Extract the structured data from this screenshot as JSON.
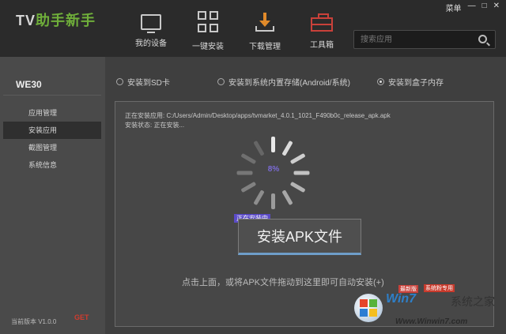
{
  "app": {
    "logo_prefix": "TV",
    "logo_main": "助手新手",
    "window_controls": [
      "菜单",
      "—",
      "□",
      "✕"
    ]
  },
  "nav": [
    {
      "label": "我的设备",
      "icon": "monitor-icon"
    },
    {
      "label": "一键安装",
      "icon": "grid-icon"
    },
    {
      "label": "下载管理",
      "icon": "download-icon"
    },
    {
      "label": "工具箱",
      "icon": "toolbox-icon"
    }
  ],
  "search": {
    "placeholder": "搜索应用"
  },
  "sidebar": {
    "device_name": "WE30",
    "items": [
      {
        "label": "应用管理",
        "active": false
      },
      {
        "label": "安装应用",
        "active": true
      },
      {
        "label": "截图管理",
        "active": false
      },
      {
        "label": "系统信息",
        "active": false
      }
    ],
    "footer_text": "当前版本 V1.0.0",
    "footer_badge": "GET"
  },
  "install_targets": [
    {
      "label": "安装到SD卡",
      "checked": false
    },
    {
      "label": "安装到系统内置存储(Android/系统)",
      "checked": false
    },
    {
      "label": "安装到盒子内存",
      "checked": true
    }
  ],
  "panel": {
    "path_line": "正在安装应用: C:/Users/Admin/Desktop/apps/tvmarket_4.0.1_1021_F490b0c_release_apk.apk",
    "status_line": "安装状态: 正在安装...",
    "progress_percent": "8%",
    "progress_tag": "正在安装中",
    "install_button_label": "安装APK文件",
    "drag_hint": "点击上面，或将APK文件拖动到这里即可自动安装(+)",
    "hint_badge": "最新版"
  },
  "watermark": {
    "brand": "Win7",
    "brand_suffix": "系统之家",
    "tag": "系统粉专用",
    "url": "Www.Winwin7.com"
  },
  "colors": {
    "topbar_bg": "#2b2b2b",
    "sidebar_bg": "#4a4a4a",
    "main_bg": "#3f3f3f",
    "accent_orange": "#e08a2a",
    "accent_red": "#c9413a",
    "progress_purple": "#5b4bc7"
  }
}
